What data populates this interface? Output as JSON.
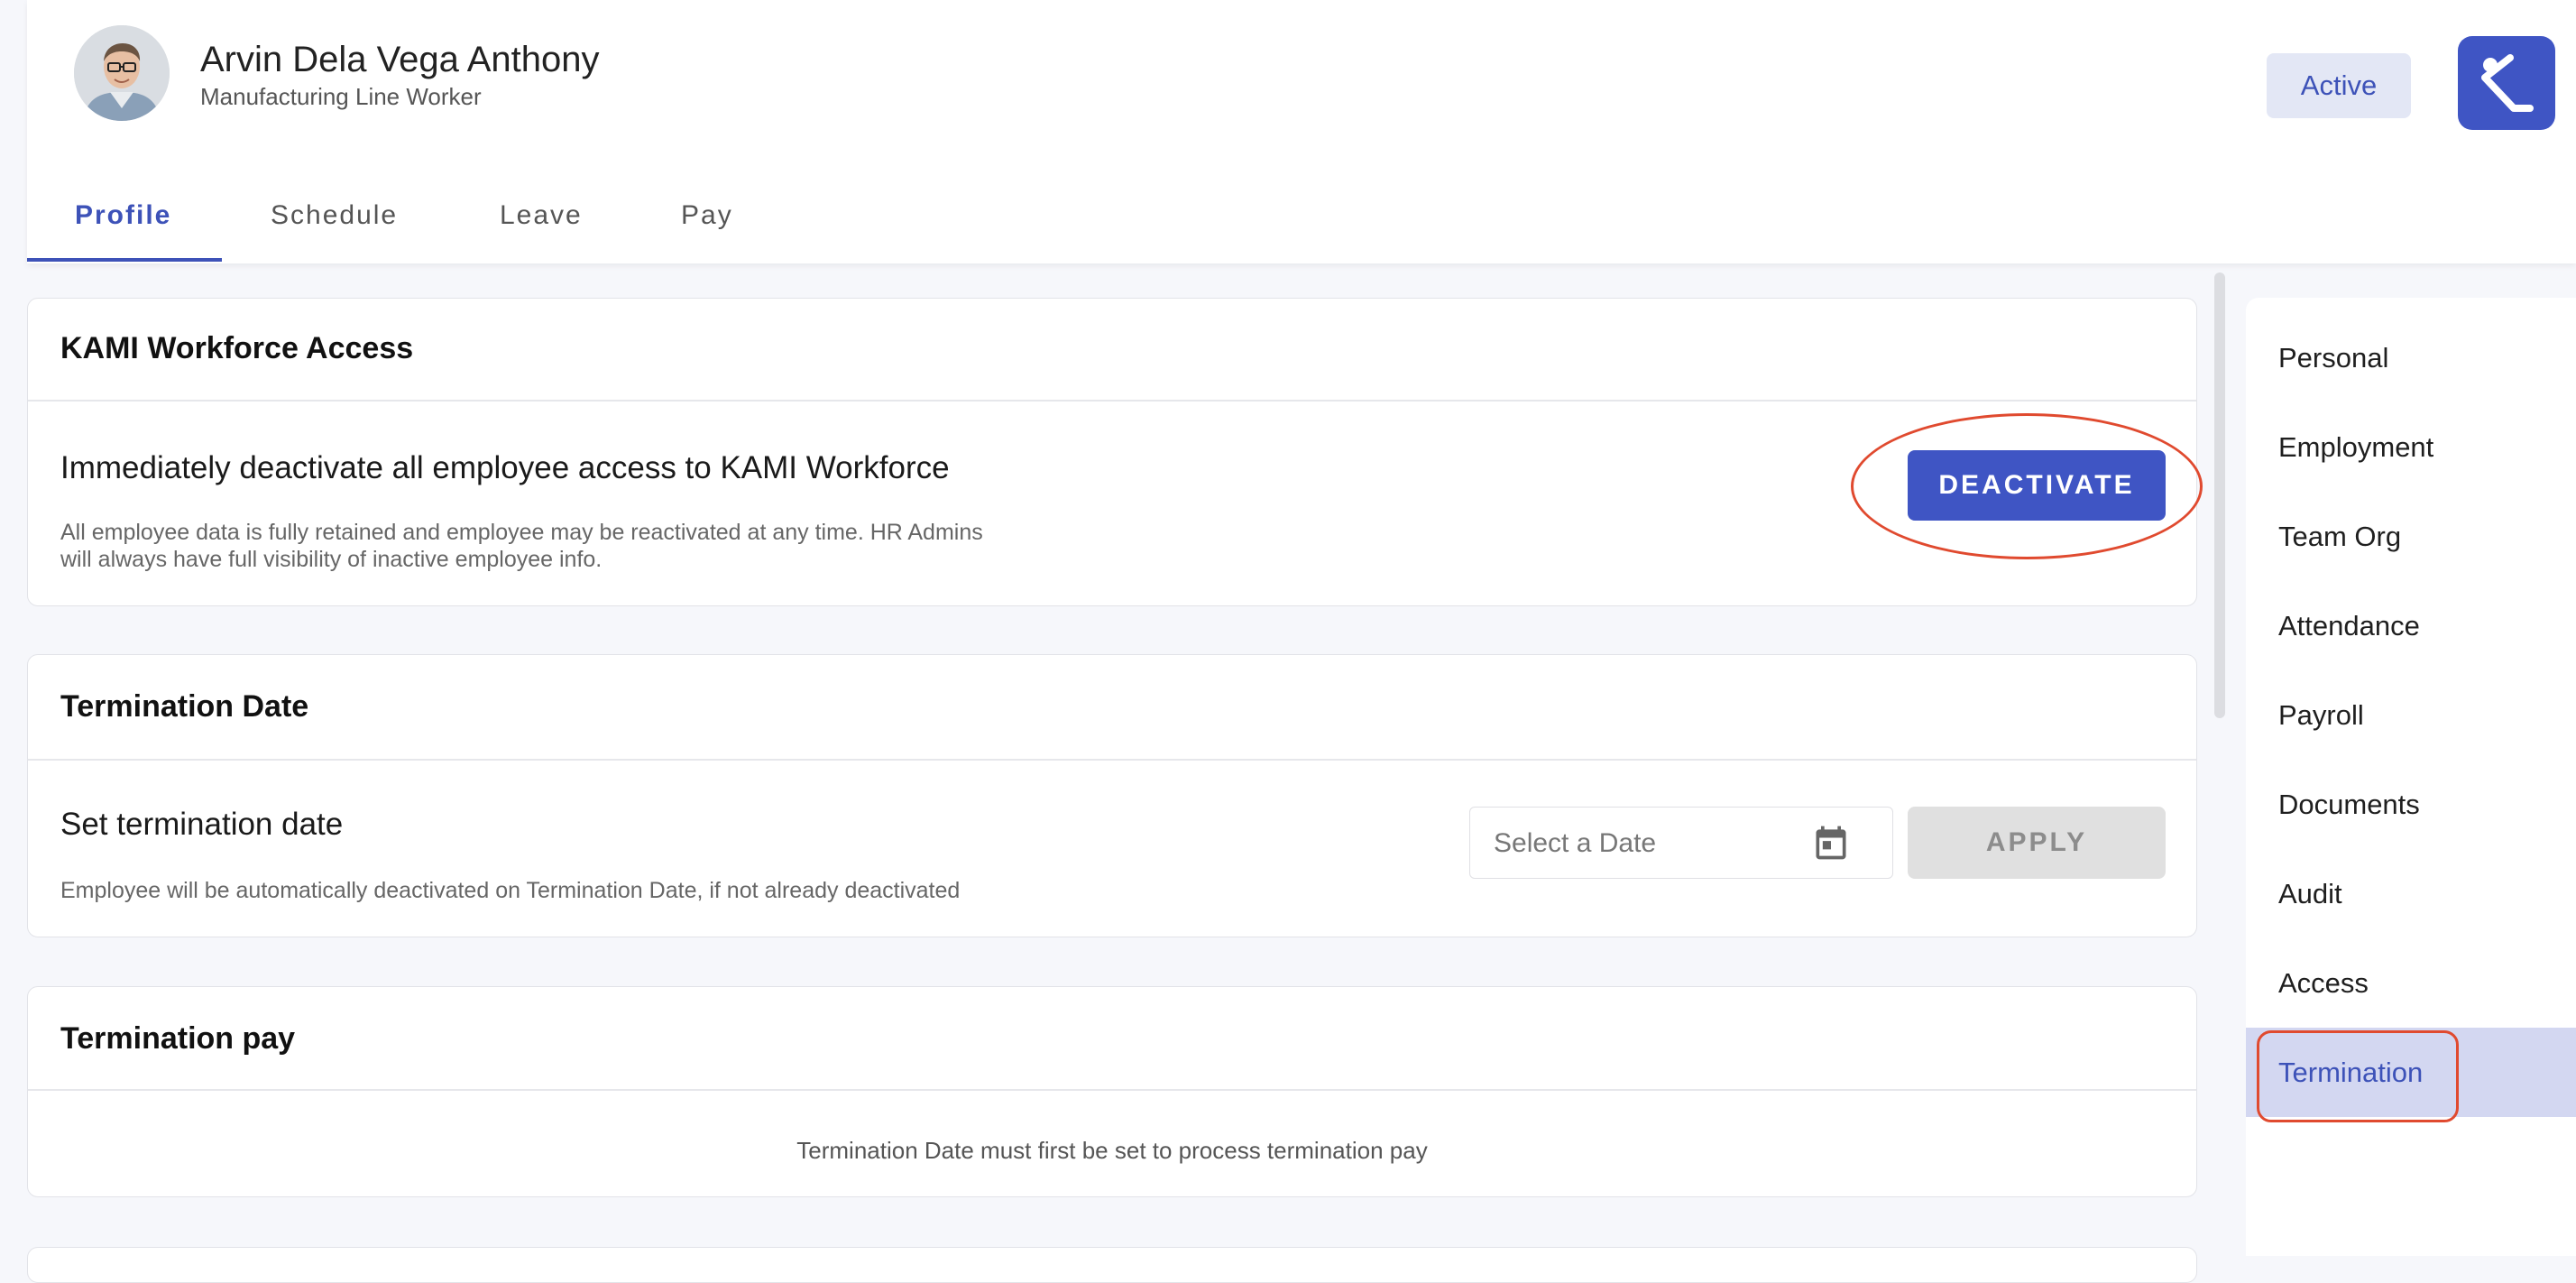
{
  "employee": {
    "name": "Arvin Dela Vega Anthony",
    "role": "Manufacturing Line Worker",
    "status": "Active"
  },
  "tabs": [
    {
      "label": "Profile",
      "active": true
    },
    {
      "label": "Schedule",
      "active": false
    },
    {
      "label": "Leave",
      "active": false
    },
    {
      "label": "Pay",
      "active": false
    }
  ],
  "access_card": {
    "title": "KAMI Workforce Access",
    "row_title": "Immediately deactivate all employee access to KAMI Workforce",
    "row_desc_line1": "All employee data is fully retained and employee may be reactivated at any time. HR Admins",
    "row_desc_line2": "will always have full visibility of inactive employee info.",
    "button_label": "DEACTIVATE"
  },
  "termination_date_card": {
    "title": "Termination Date",
    "row_title": "Set termination date",
    "row_desc": "Employee will be automatically deactivated on Termination Date, if not already deactivated",
    "date_placeholder": "Select a Date",
    "date_value": "",
    "button_label": "APPLY"
  },
  "termination_pay_card": {
    "title": "Termination pay",
    "message": "Termination Date must first be set to process termination pay"
  },
  "sidenav": {
    "items": [
      {
        "label": "Personal",
        "active": false
      },
      {
        "label": "Employment",
        "active": false
      },
      {
        "label": "Team Org",
        "active": false
      },
      {
        "label": "Attendance",
        "active": false
      },
      {
        "label": "Payroll",
        "active": false
      },
      {
        "label": "Documents",
        "active": false
      },
      {
        "label": "Audit",
        "active": false
      },
      {
        "label": "Access",
        "active": false
      },
      {
        "label": "Termination",
        "active": true
      }
    ]
  },
  "icons": {
    "calendar": "calendar-icon",
    "logo": "kami-logo"
  },
  "colors": {
    "accent": "#3f55c4",
    "highlight_annotation": "#e04a2f",
    "active_nav_bg": "#d3d7f1"
  }
}
